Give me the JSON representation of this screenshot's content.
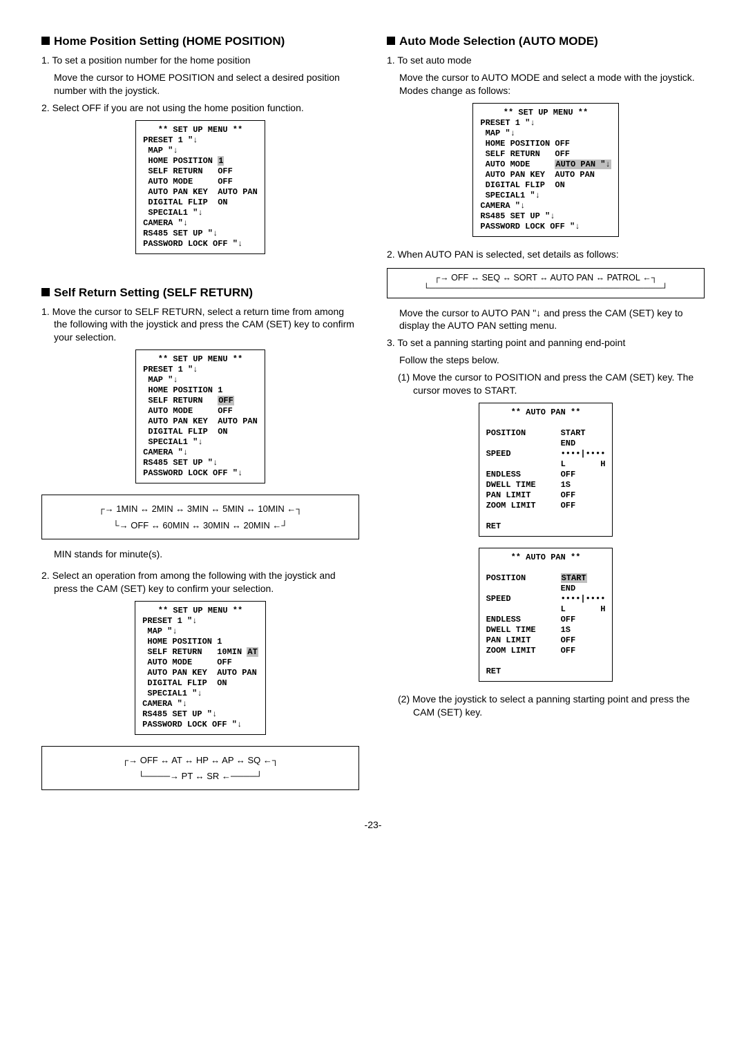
{
  "left": {
    "home": {
      "title": "Home Position Setting (HOME POSITION)",
      "p1": "1. To set a position number for the home position",
      "p1a": "Move the cursor to HOME POSITION and select a desired position number with the joystick.",
      "p2": "2. Select OFF if you are not using the home position function."
    },
    "self": {
      "title": "Self Return Setting (SELF RETURN)",
      "p1": "1. Move the cursor to SELF RETURN, select a return time from among the following with the joystick and press the CAM (SET) key to confirm your selection.",
      "cycle1_line1": "1MIN ↔ 2MIN ↔ 3MIN ↔ 5MIN ↔ 10MIN",
      "cycle1_line2": "OFF ↔ 60MIN ↔ 30MIN ↔ 20MIN",
      "note": "MIN stands for minute(s).",
      "p2": "2. Select an operation from among the following with the joystick and press the CAM (SET) key to confirm your selection.",
      "cycle2_line1": "OFF ↔ AT ↔ HP ↔ AP ↔ SQ",
      "cycle2_line2": "PT ↔ SR"
    },
    "menu1": {
      "title": "** SET UP MENU **",
      "l1": "PRESET 1 \"↓",
      "l2": " MAP \"↓",
      "l3": " HOME POSITION ",
      "l3hl": "1",
      "l4": " SELF RETURN   OFF",
      "l5": " AUTO MODE     OFF",
      "l6": " AUTO PAN KEY  AUTO PAN",
      "l7": " DIGITAL FLIP  ON",
      "l8": " SPECIAL1 \"↓",
      "l9": "CAMERA \"↓",
      "l10": "RS485 SET UP \"↓",
      "l11": "PASSWORD LOCK OFF \"↓"
    },
    "menu2": {
      "title": "** SET UP MENU **",
      "l1": "PRESET 1 \"↓",
      "l2": " MAP \"↓",
      "l3": " HOME POSITION 1",
      "l4a": " SELF RETURN   ",
      "l4hl": "OFF",
      "l5": " AUTO MODE     OFF",
      "l6": " AUTO PAN KEY  AUTO PAN",
      "l7": " DIGITAL FLIP  ON",
      "l8": " SPECIAL1 \"↓",
      "l9": "CAMERA \"↓",
      "l10": "RS485 SET UP \"↓",
      "l11": "PASSWORD LOCK OFF \"↓"
    },
    "menu3": {
      "title": "** SET UP MENU **",
      "l1": "PRESET 1 \"↓",
      "l2": " MAP \"↓",
      "l3": " HOME POSITION 1",
      "l4a": " SELF RETURN   10MIN ",
      "l4hl": "AT",
      "l5": " AUTO MODE     OFF",
      "l6": " AUTO PAN KEY  AUTO PAN",
      "l7": " DIGITAL FLIP  ON",
      "l8": " SPECIAL1 \"↓",
      "l9": "CAMERA \"↓",
      "l10": "RS485 SET UP \"↓",
      "l11": "PASSWORD LOCK OFF \"↓"
    }
  },
  "right": {
    "auto": {
      "title": "Auto Mode Selection (AUTO MODE)",
      "p1": "1. To set auto mode",
      "p1a": "Move the cursor to AUTO MODE and select a mode with the joystick. Modes change as follows:",
      "p2": "2. When AUTO PAN is selected, set details as follows:",
      "cycle": "OFF ↔ SEQ ↔ SORT ↔ AUTO PAN ↔ PATROL",
      "p2a": "Move the cursor to AUTO PAN \"↓ and press the CAM (SET) key to display the AUTO PAN setting menu.",
      "p3": "3. To set a panning starting point and panning end-point",
      "p3a": "Follow the steps below.",
      "s1": "(1) Move the cursor to POSITION and press the CAM (SET) key. The cursor moves to START.",
      "s2": "(2) Move the joystick to select a panning starting point and press the CAM (SET) key."
    },
    "menu1": {
      "title": "** SET UP MENU **",
      "l1": "PRESET 1 \"↓",
      "l2": " MAP \"↓",
      "l3": " HOME POSITION OFF",
      "l4": " SELF RETURN   OFF",
      "l5a": " AUTO MODE     ",
      "l5hl": "AUTO PAN \"↓",
      "l6": " AUTO PAN KEY  AUTO PAN",
      "l7": " DIGITAL FLIP  ON",
      "l8": " SPECIAL1 \"↓",
      "l9": "CAMERA \"↓",
      "l10": "RS485 SET UP \"↓",
      "l11": "PASSWORD LOCK OFF \"↓"
    },
    "apmenu1": {
      "title": "** AUTO PAN **",
      "l1": "POSITION       START",
      "l2": "               END",
      "l3": "SPEED          ••••|••••",
      "l4": "               L       H",
      "l5": "ENDLESS        OFF",
      "l6": "DWELL TIME     1S",
      "l7": "PAN LIMIT      OFF",
      "l8": "ZOOM LIMIT     OFF",
      "l9": "",
      "l10": "RET"
    },
    "apmenu2": {
      "title": "** AUTO PAN **",
      "l1a": "POSITION       ",
      "l1hl": "START",
      "l2": "               END",
      "l3": "SPEED          ••••|••••",
      "l4": "               L       H",
      "l5": "ENDLESS        OFF",
      "l6": "DWELL TIME     1S",
      "l7": "PAN LIMIT      OFF",
      "l8": "ZOOM LIMIT     OFF",
      "l9": "",
      "l10": "RET"
    }
  },
  "pagenum": "-23-"
}
